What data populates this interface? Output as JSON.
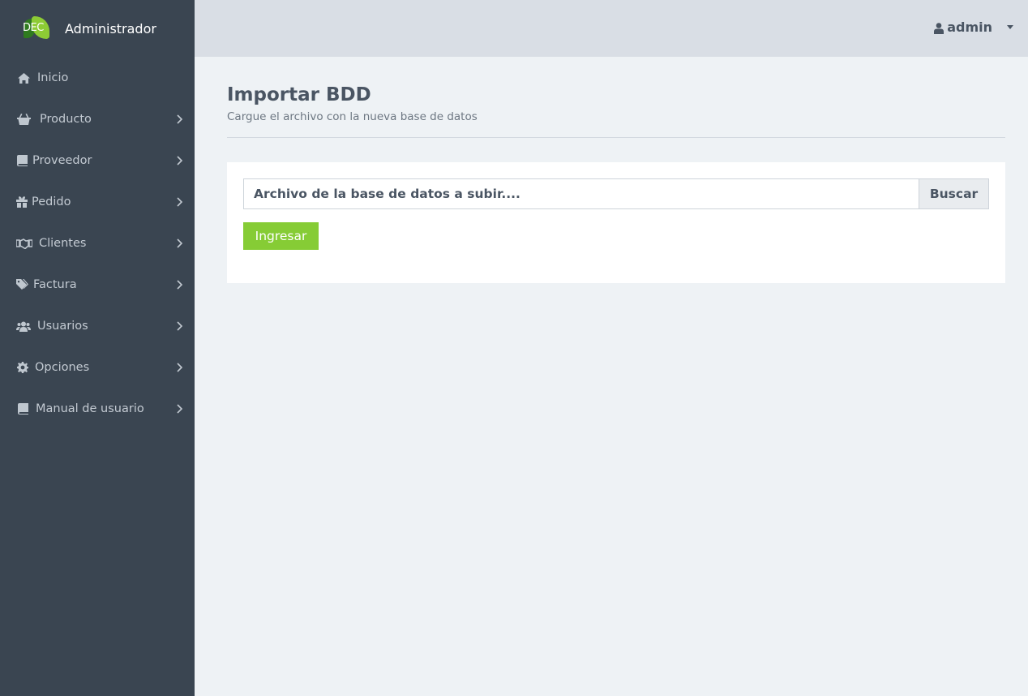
{
  "sidebar": {
    "brand": {
      "logo_text": "DEC",
      "title": "Administrador"
    },
    "items": [
      {
        "label": "Inicio",
        "icon": "home-icon"
      },
      {
        "label": "Producto",
        "icon": "basket-icon"
      },
      {
        "label": "Proveedor",
        "icon": "book-icon"
      },
      {
        "label": "Pedido",
        "icon": "gift-icon"
      },
      {
        "label": "Clientes",
        "icon": "handshake-icon"
      },
      {
        "label": "Factura",
        "icon": "tags-icon"
      },
      {
        "label": "Usuarios",
        "icon": "users-icon"
      },
      {
        "label": "Opciones",
        "icon": "gear-icon"
      },
      {
        "label": "Manual de usuario",
        "icon": "book-icon"
      }
    ]
  },
  "header": {
    "user": "admin",
    "user_icon": "user-icon"
  },
  "page": {
    "title": "Importar BDD",
    "subtitle": "Cargue el archivo con la nueva base de datos"
  },
  "form": {
    "file_label": "Archivo de la base de datos a subir....",
    "browse_label": "Buscar",
    "submit_label": "Ingresar"
  },
  "colors": {
    "sidebar_bg": "#3a4551",
    "topbar_bg": "#d9dee5",
    "content_bg": "#eef2f5",
    "accent_green": "#86cc35"
  }
}
